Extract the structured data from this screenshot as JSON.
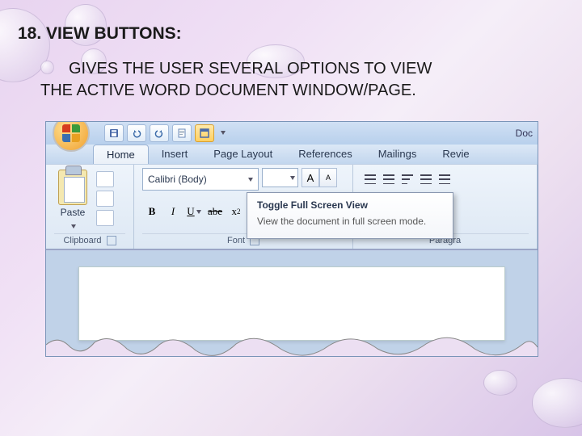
{
  "slide": {
    "title": "18. VIEW BUTTONS:",
    "body_line1": "GIVES THE USER SEVERAL OPTIONS TO VIEW",
    "body_line2": "THE ACTIVE WORD DOCUMENT WINDOW/PAGE."
  },
  "word": {
    "doc_title_fragment": "Doc",
    "tabs": {
      "home": "Home",
      "insert": "Insert",
      "page_layout": "Page Layout",
      "references": "References",
      "mailings": "Mailings",
      "review": "Revie"
    },
    "groups": {
      "clipboard": "Clipboard",
      "font": "Font",
      "paragraph": "Paragra"
    },
    "clipboard": {
      "paste": "Paste"
    },
    "font": {
      "name": "Calibri (Body)",
      "bold": "B",
      "italic": "I",
      "underline": "U",
      "strike": "abe",
      "x2_base": "x",
      "x2_sub": "2",
      "grow": "A",
      "shrink": "A"
    },
    "tooltip": {
      "title": "Toggle Full Screen View",
      "body": "View the document in full screen mode."
    }
  }
}
